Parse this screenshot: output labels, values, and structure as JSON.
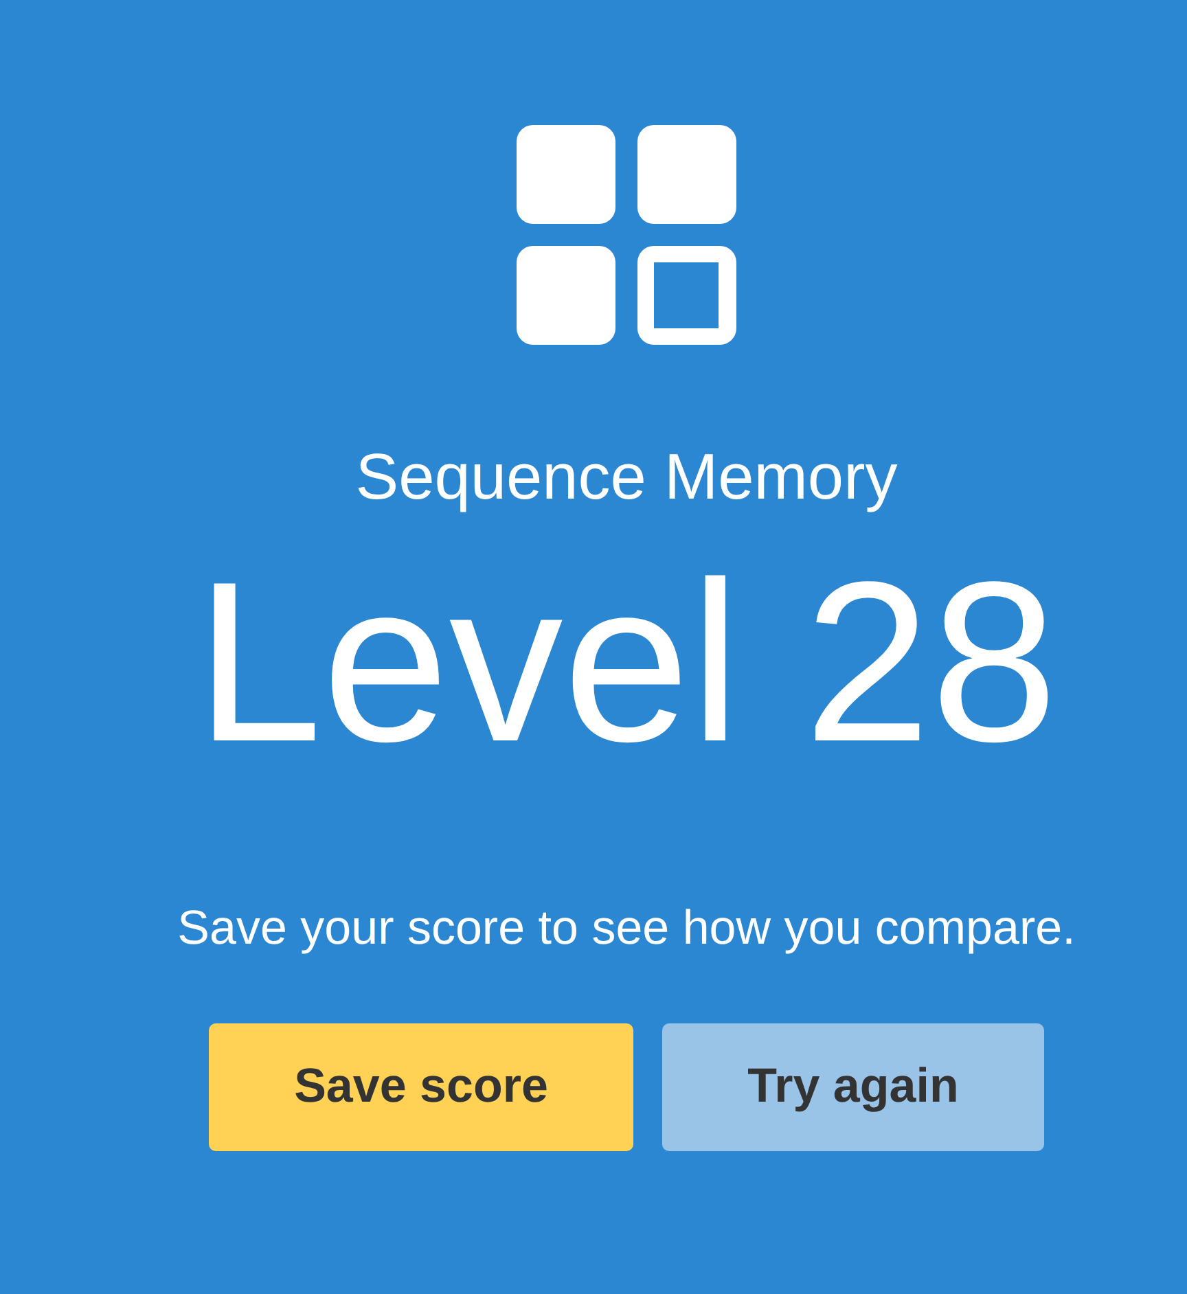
{
  "game": {
    "title": "Sequence Memory",
    "result": "Level 28"
  },
  "prompt": "Save your score to see how you compare.",
  "buttons": [
    {
      "label": "Save score",
      "kind": "primary"
    },
    {
      "label": "Try again",
      "kind": "secondary"
    }
  ]
}
